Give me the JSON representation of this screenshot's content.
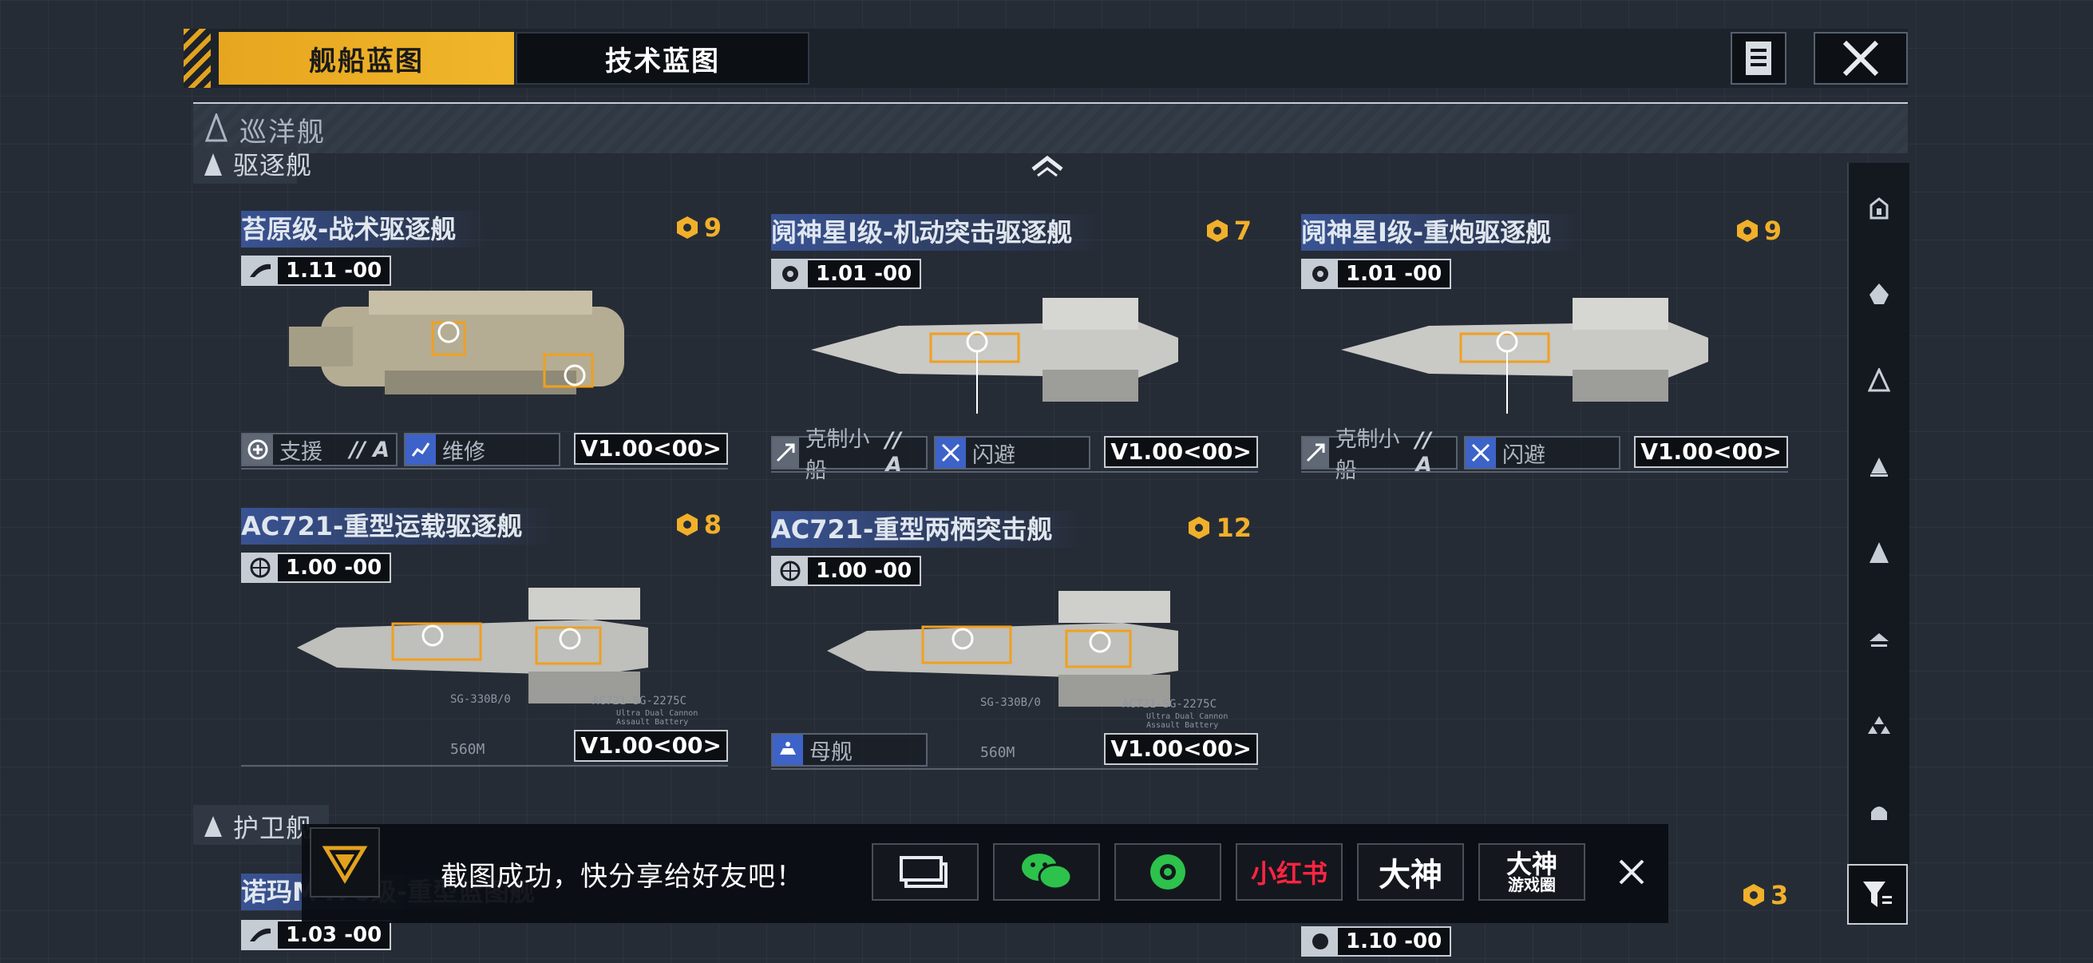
{
  "tabs": [
    {
      "label": "舰船蓝图",
      "active": true
    },
    {
      "label": "技术蓝图",
      "active": false
    }
  ],
  "section": {
    "label": "巡洋舰"
  },
  "subsection_destroyer": "驱逐舰",
  "subsection_frigate": "护卫舰",
  "cards": [
    {
      "name": "苔原级-战术驱逐舰",
      "cost": "9",
      "version": "1.11 -00",
      "tag1": "支援",
      "tag1_grade": "// A",
      "tag2": "维修",
      "v_badge": "V1.00<00>"
    },
    {
      "name": "阋神星I级-机动突击驱逐舰",
      "cost": "7",
      "version": "1.01 -00",
      "tag1": "克制小船",
      "tag1_grade": "// A",
      "tag2": "闪避",
      "v_badge": "V1.00<00>"
    },
    {
      "name": "阋神星I级-重炮驱逐舰",
      "cost": "9",
      "version": "1.01 -00",
      "tag1": "克制小船",
      "tag1_grade": "// A",
      "tag2": "闪避",
      "v_badge": "V1.00<00>"
    },
    {
      "name": "AC721-重型运载驱逐舰",
      "cost": "8",
      "version": "1.00 -00",
      "v_badge": "V1.00<00>",
      "label_a": "SG-330B/0",
      "label_b": "AC721-SG-2275C",
      "label_c": "Ultra Dual Cannon Assault Battery",
      "length": "560M"
    },
    {
      "name": "AC721-重型两栖突击舰",
      "cost": "12",
      "version": "1.00 -00",
      "tag2": "母舰",
      "v_badge": "V1.00<00>",
      "label_a": "SG-330B/0",
      "label_b": "AC721-SG-2275C",
      "label_c": "Ultra Dual Cannon Assault Battery",
      "length": "560M"
    }
  ],
  "bottom_row": {
    "name": "诺玛M470级-重型蓝图舰",
    "version1": "1.03 -00",
    "version2": "1.10 -00",
    "cost": "3"
  },
  "share": {
    "message": "截图成功，快分享给好友吧！",
    "buttons": [
      "小红书",
      "大神",
      "大神\n游戏圈"
    ],
    "btn_xhs": "小红书",
    "btn_dashen": "大神",
    "btn_dashen_top": "大神",
    "btn_dashen_bottom": "游戏圈"
  },
  "colors": {
    "accent": "#f0b62a",
    "blue_tag": "#3d63c9",
    "bg": "#262c36"
  }
}
